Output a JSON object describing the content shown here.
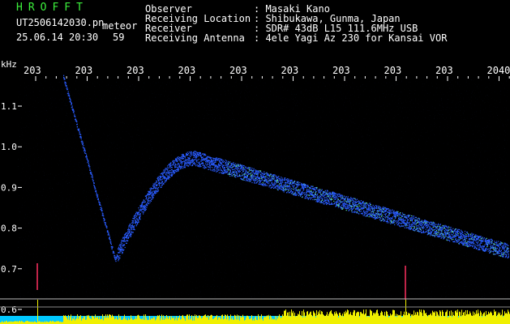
{
  "header": {
    "app_name": "HROFFT",
    "file_name": "UT2506142030.pn",
    "tag": "meteor",
    "datetime": "25.06.14 20:30",
    "count": "59",
    "info_labels": [
      "Observer",
      "Receiving Location",
      "Receiver",
      "Receiving Antenna"
    ],
    "info_values": [
      ": Masaki Kano",
      ": Shibukawa, Gunma, Japan",
      ": SDR# 43dB L15 111.6MHz USB",
      ": 4ele Yagi Az 230 for Kansai VOR"
    ]
  },
  "axes": {
    "y_unit": "kHz",
    "y_ticks": [
      "1.1",
      "1.0",
      "0.9",
      "0.8",
      "0.7",
      "0.6"
    ],
    "x_ticks": [
      "203",
      "203",
      "203",
      "203",
      "203",
      "203",
      "203",
      "203",
      "203",
      "2040"
    ]
  },
  "colors": {
    "background": "#000000",
    "signal": "#2a5cff",
    "signal_hot": "#60e0a0",
    "level_bar": "#f0f000",
    "level_low": "#00c8ff",
    "header_green": "#3cf03c"
  }
}
